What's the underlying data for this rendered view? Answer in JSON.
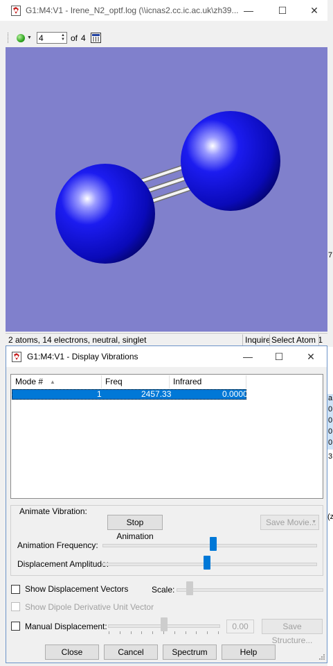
{
  "main_window": {
    "title": "G1:M4:V1 - Irene_N2_optf.log (\\\\icnas2.cc.ic.ac.uk\\zh39...",
    "toolbar": {
      "frame_value": "4",
      "of_label": "of",
      "total_frames": "4"
    },
    "status": {
      "summary": "2 atoms, 14 electrons, neutral, singlet",
      "mode": "Inquire",
      "action": "Select Atom 1"
    },
    "colors": {
      "background": "#8080cc",
      "atom": "#0a0ad2",
      "bond": "#e8e8e8"
    }
  },
  "dialog": {
    "title": "G1:M4:V1 - Display Vibrations",
    "columns": [
      "Mode #",
      "Freq",
      "Infrared"
    ],
    "rows": [
      {
        "mode": "1",
        "freq": "2457.33",
        "infrared": "0.0000"
      }
    ],
    "animate_group_label": "Animate Vibration:",
    "stop_animation": "Stop Animation",
    "save_movie": "Save Movie...",
    "animation_frequency_label": "Animation Frequency:",
    "animation_frequency": 0.52,
    "displacement_amplitude_label": "Displacement Amplitude:",
    "displacement_amplitude": 0.49,
    "show_displacement_vectors": "Show Displacement Vectors",
    "scale_label": "Scale:",
    "show_dipole": "Show Dipole Derivative Unit Vector",
    "manual_displacement": "Manual Displacement:",
    "manual_value": "0.00",
    "save_structure": "Save Structure...",
    "buttons": {
      "close": "Close",
      "cancel": "Cancel",
      "spectrum": "Spectrum",
      "help": "Help"
    }
  },
  "window_controls": {
    "minimize": "—",
    "maximize": "☐",
    "close": "✕"
  },
  "background_app_glyphs": [
    "7",
    "a",
    "0",
    "0",
    "0",
    "0",
    "3",
    "(z"
  ]
}
